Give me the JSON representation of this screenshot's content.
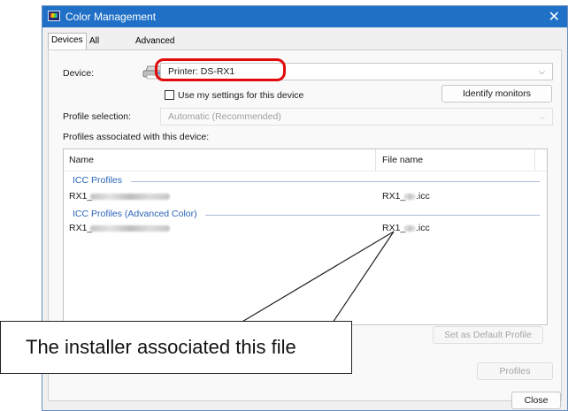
{
  "window": {
    "title": "Color Management",
    "close_glyph": "✕",
    "icon": "color-management-icon"
  },
  "tabs": [
    "Devices",
    "All Profiles",
    "Advanced"
  ],
  "device_section": {
    "device_label": "Device:",
    "device_value": "Printer: DS-RX1",
    "device_icon": "printer-icon",
    "use_settings_label": "Use my settings for this device",
    "identify_button": "Identify monitors",
    "profile_selection_label": "Profile selection:",
    "profile_selection_value": "Automatic (Recommended)",
    "profiles_associated_label": "Profiles associated with this device:"
  },
  "profiles_table": {
    "columns": [
      "Name",
      "File name"
    ],
    "groups": [
      {
        "label": "ICC Profiles",
        "rows": [
          {
            "name": "RX1_",
            "file": "RX1_",
            "file_ext": ".icc"
          }
        ]
      },
      {
        "label": "ICC Profiles (Advanced Color)",
        "rows": [
          {
            "name": "RX1_",
            "file": "RX1_",
            "file_ext": ".icc"
          }
        ]
      }
    ]
  },
  "buttons": {
    "set_default": "Set as Default Profile",
    "profiles": "Profiles",
    "close": "Close"
  },
  "callout": {
    "text": "The installer associated this file"
  },
  "colors": {
    "titlebar": "#1f70c6",
    "highlight": "#e20b0b",
    "group_text": "#2a64b6"
  },
  "chevron_glyph": "⌵"
}
